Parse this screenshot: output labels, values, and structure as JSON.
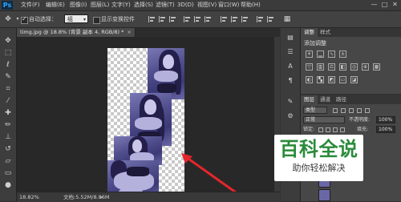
{
  "app": {
    "logo": "Ps",
    "menu": [
      "文件(F)",
      "编辑(E)",
      "图像(I)",
      "图层(L)",
      "文字(Y)",
      "选择(S)",
      "滤镜(T)",
      "3D(D)",
      "视图(V)",
      "窗口(W)",
      "帮助(H)"
    ],
    "window_controls": [
      "—",
      "□",
      "✕"
    ]
  },
  "options": {
    "auto_select_label": "自动选择：",
    "auto_select_value": "组",
    "show_transform_label": "显示变换控件"
  },
  "document": {
    "tab_title": "timg.jpg @ 18.8% (背景 副本 4, RGB/8) *",
    "tab_close": "×",
    "zoom": "18.82%",
    "doc_info": "文档:5.52M/8.86M"
  },
  "panels": {
    "adjustments_tabs": [
      "调整",
      "样式"
    ],
    "adjustments_title": "添加调整",
    "layers_tabs": [
      "图层",
      "通道",
      "路径"
    ],
    "filter_label": "类型",
    "blend_mode": "正常",
    "opacity_label": "不透明度:",
    "opacity_value": "100%",
    "lock_label": "锁定:",
    "fill_label": "填充:",
    "fill_value": "100%"
  },
  "watermark": {
    "title": "百科全说",
    "subtitle": "助你轻松解决"
  },
  "colors": {
    "watermark_green": "#2a8b3a",
    "arrow_red": "#e3262b",
    "photo_tint": "#6a67a6"
  }
}
